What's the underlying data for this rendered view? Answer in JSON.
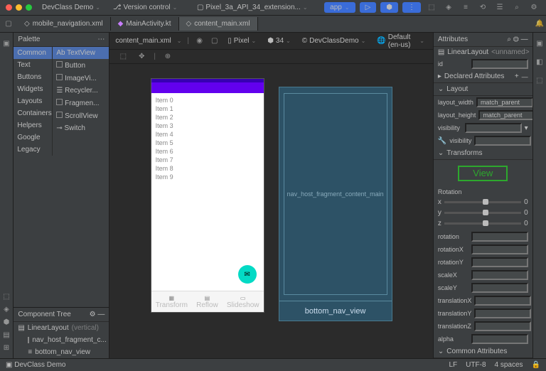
{
  "titlebar": {
    "project": "DevClass Demo",
    "vcs": "Version control",
    "device": "Pixel_3a_API_34_extension...",
    "run": "app"
  },
  "tabs": [
    {
      "label": "mobile_navigation.xml"
    },
    {
      "label": "MainActivity.kt"
    },
    {
      "label": "content_main.xml",
      "active": true
    }
  ],
  "editorHeader": {
    "file": "content_main.xml",
    "device": "Pixel",
    "api": "34",
    "theme": "DevClassDemo",
    "locale": "Default (en-us)"
  },
  "palette": {
    "title": "Palette",
    "categories": [
      "Common",
      "Text",
      "Buttons",
      "Widgets",
      "Layouts",
      "Containers",
      "Helpers",
      "Google",
      "Legacy"
    ],
    "items": [
      "Ab TextView",
      "Button",
      "ImageVi...",
      "Recycler...",
      "Fragmen...",
      "ScrollView",
      "Switch"
    ]
  },
  "componentTree": {
    "title": "Component Tree",
    "root": "LinearLayout",
    "rootNote": "(vertical)",
    "children": [
      "nav_host_fragment_c...",
      "bottom_nav_view"
    ]
  },
  "preview": {
    "items": [
      "Item 0",
      "Item 1",
      "Item 2",
      "Item 3",
      "Item 4",
      "Item 5",
      "Item 6",
      "Item 7",
      "Item 8",
      "Item 9"
    ],
    "nav": [
      "Transform",
      "Reflow",
      "Slideshow"
    ]
  },
  "blueprint": {
    "main": "nav_host_fragment_content_main",
    "bottom": "bottom_nav_view"
  },
  "attrs": {
    "title": "Attributes",
    "component": "LinearLayout",
    "name": "<unnamed>",
    "idLabel": "id",
    "declared": "Declared Attributes",
    "layout": "Layout",
    "layout_width": {
      "k": "layout_width",
      "v": "match_parent"
    },
    "layout_height": {
      "k": "layout_height",
      "v": "match_parent"
    },
    "visibility": "visibility",
    "toolsVis": "visibility",
    "transforms": "Transforms",
    "viewLabel": "View",
    "rotation": "Rotation",
    "axes": [
      "x",
      "y",
      "z"
    ],
    "axisVal": "0",
    "props": [
      "rotation",
      "rotationX",
      "rotationY",
      "scaleX",
      "scaleY",
      "translationX",
      "translationY",
      "translationZ",
      "alpha"
    ],
    "common": "Common Attributes"
  },
  "status": {
    "project": "DevClass Demo",
    "lf": "LF",
    "enc": "UTF-8",
    "indent": "4 spaces"
  }
}
